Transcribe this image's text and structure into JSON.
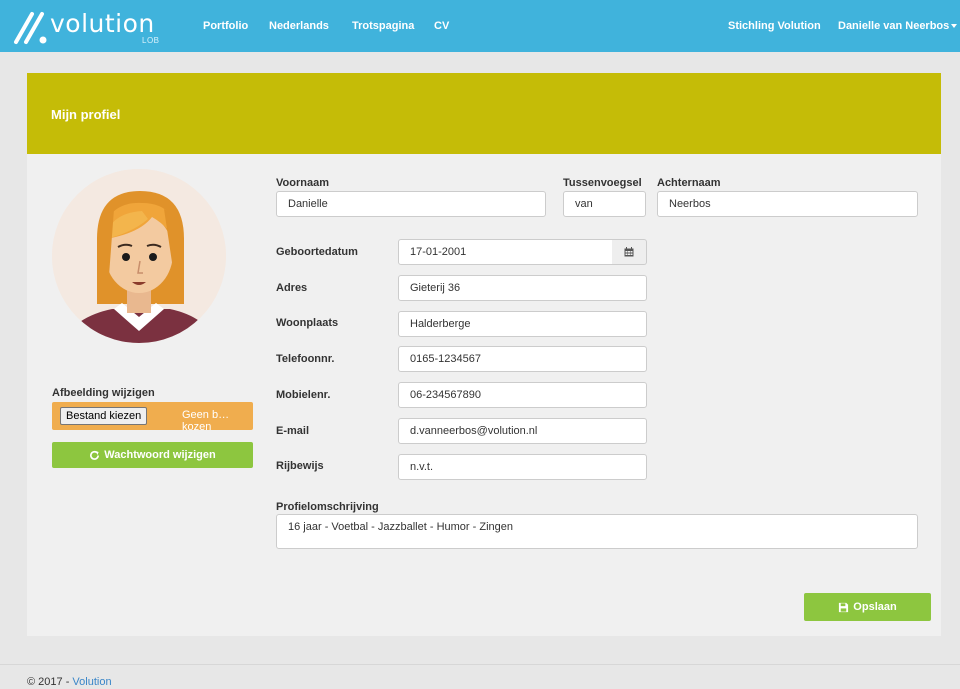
{
  "brand": {
    "name": "volution",
    "sub": "LOB"
  },
  "nav": {
    "links": [
      "Portfolio",
      "Nederlands",
      "Trotspagina",
      "CV"
    ],
    "right_link": "Stichling Volution",
    "user": "Danielle van Neerbos"
  },
  "panel": {
    "title": "Mijn profiel"
  },
  "image": {
    "label": "Afbeelding wijzigen",
    "file_button": "Bestand kiezen",
    "file_name": "Geen b…kozen"
  },
  "password_button": "Wachtwoord wijzigen",
  "form": {
    "first_name": {
      "label": "Voornaam",
      "value": "Danielle"
    },
    "infix": {
      "label": "Tussenvoegsel",
      "value": "van"
    },
    "last_name": {
      "label": "Achternaam",
      "value": "Neerbos"
    },
    "birth_date": {
      "label": "Geboortedatum",
      "value": "17-01-2001"
    },
    "address": {
      "label": "Adres",
      "value": "Gieterij 36"
    },
    "city": {
      "label": "Woonplaats",
      "value": "Halderberge"
    },
    "phone": {
      "label": "Telefoonnr.",
      "value": "0165-1234567"
    },
    "mobile": {
      "label": "Mobielenr.",
      "value": "06-234567890"
    },
    "email": {
      "label": "E-mail",
      "value": "d.vanneerbos@volution.nl"
    },
    "license": {
      "label": "Rijbewijs",
      "value": "n.v.t."
    },
    "description": {
      "label": "Profielomschrijving",
      "value": "16 jaar - Voetbal - Jazzballet - Humor - Zingen"
    }
  },
  "save_button": "Opslaan",
  "footer": {
    "copyright": "© 2017 -",
    "link": "Volution"
  },
  "colors": {
    "navbar": "#40b3dc",
    "panel_header": "#c5bc07",
    "orange": "#f0ad4e",
    "green": "#8dc63f",
    "link": "#3a86c8"
  },
  "icons": {
    "calendar": "calendar-icon",
    "refresh": "refresh-icon",
    "save": "floppy-disk-icon",
    "caret": "caret-down-icon"
  }
}
